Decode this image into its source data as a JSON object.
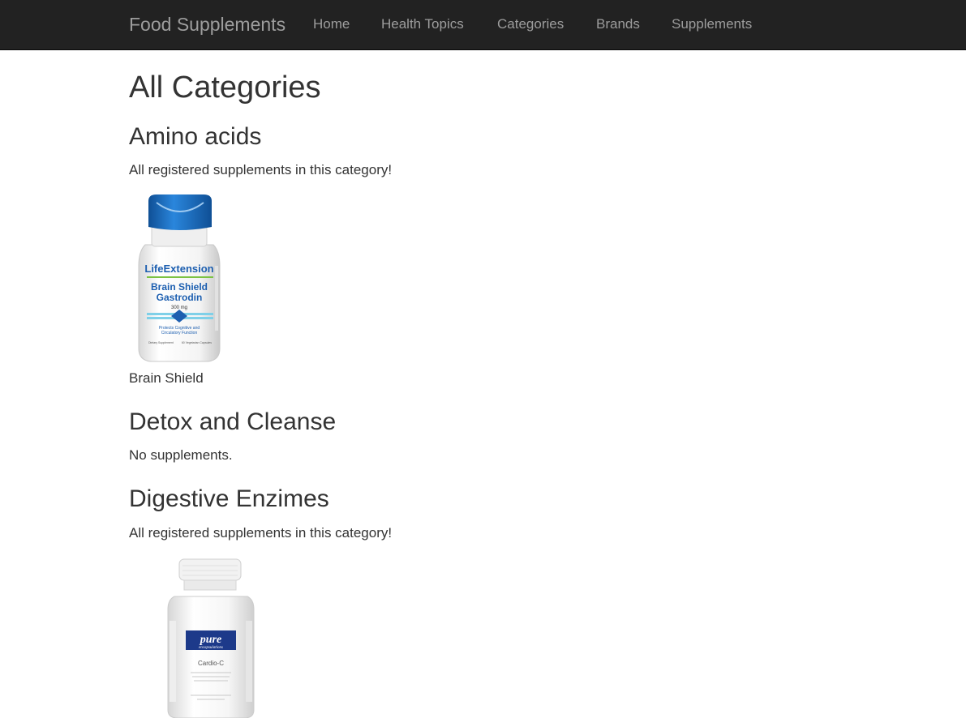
{
  "navbar": {
    "brand": "Food Supplements",
    "links": [
      "Home",
      "Health Topics",
      "Categories",
      "Brands",
      "Supplements"
    ]
  },
  "page": {
    "title": "All Categories"
  },
  "categories": [
    {
      "name": "Amino acids",
      "description": "All registered supplements in this category!",
      "products": [
        {
          "name": "Brain Shield",
          "image_label": {
            "brand": "LifeExtension",
            "line1": "Brain Shield",
            "line2": "Gastrodin",
            "dose": "300 mg",
            "tagline1": "Protects Cognitive and",
            "tagline2": "Circulatory Function",
            "count": "60 Vegetarian Capsules",
            "type": "Dietary Supplement"
          }
        }
      ]
    },
    {
      "name": "Detox and Cleanse",
      "description": "No supplements.",
      "products": []
    },
    {
      "name": "Digestive Enzimes",
      "description": "All registered supplements in this category!",
      "products": [
        {
          "name": "",
          "image_label": {
            "brand": "pure",
            "sub": "encapsulations",
            "product": "Cardio-C"
          }
        }
      ]
    }
  ],
  "colors": {
    "navbar_bg": "#222222",
    "nav_text": "#9d9d9d",
    "body_text": "#333333",
    "cap_blue": "#1f6fc0",
    "pure_blue": "#1d3a8a"
  }
}
